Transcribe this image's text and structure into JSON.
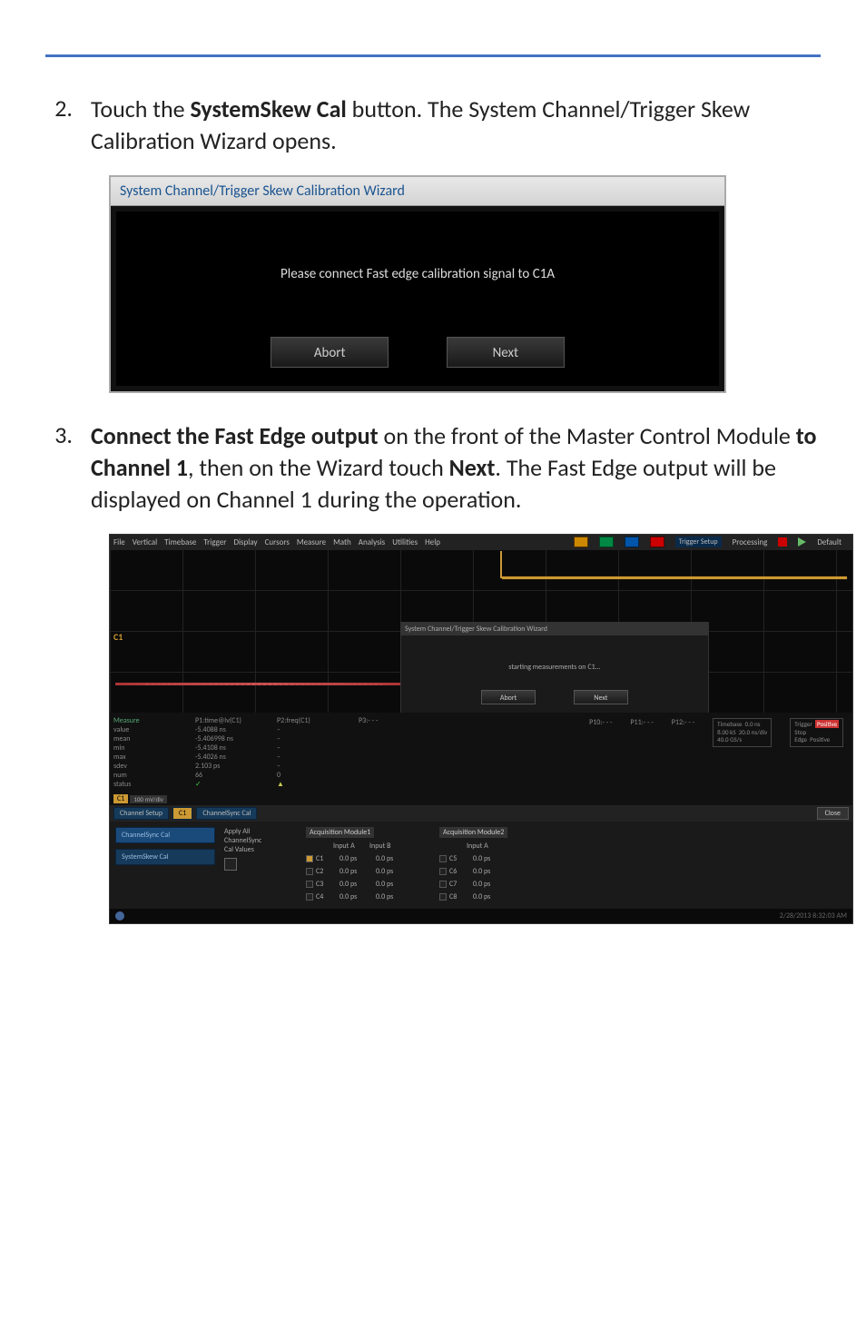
{
  "instructions": {
    "step2": {
      "num": "2.",
      "prefix": "Touch the ",
      "bold1": "SystemSkew Cal",
      "suffix": " button. The System Channel/Trigger Skew Calibration Wizard opens."
    },
    "step3": {
      "num": "3.",
      "bold1": "Connect the Fast Edge output",
      "mid1": " on the front of the Master Control Module ",
      "bold2": "to Channel 1",
      "mid2": ", then on the Wizard touch ",
      "bold3": "Next",
      "suffix": ".  The Fast Edge output will be displayed on Channel 1 during the operation."
    }
  },
  "dialog": {
    "title": "System Channel/Trigger Skew Calibration Wizard",
    "message": "Please connect Fast edge calibration signal to C1A",
    "abort": "Abort",
    "next": "Next"
  },
  "scope": {
    "menu": [
      "File",
      "Vertical",
      "Timebase",
      "Trigger",
      "Display",
      "Cursors",
      "Measure",
      "Math",
      "Analysis",
      "Utilities",
      "Help"
    ],
    "trigger_setup": "Trigger Setup",
    "processing": "Processing",
    "default": "Default",
    "inner_wizard": {
      "title": "System Channel/Trigger Skew Calibration Wizard",
      "message": "starting measurements on C1...",
      "abort": "Abort",
      "next": "Next"
    },
    "ch_label": "C1",
    "measure": {
      "header_measure": "Measure",
      "header_p1": "P1:time@lv(C1)",
      "header_p2": "P2:freq(C1)",
      "header_p3": "P3:- - -",
      "rows_lbl": [
        "value",
        "mean",
        "min",
        "max",
        "sdev",
        "num",
        "status"
      ],
      "rows_p1": [
        "-5.4088 ns",
        "-5.406998 ns",
        "-5.4108 ns",
        "-5.4026 ns",
        "2.103 ps",
        "66",
        "✓"
      ],
      "rows_p2": [
        "–",
        "–",
        "–",
        "–",
        "–",
        "0",
        "▲"
      ],
      "badge_c1": "C1",
      "badge_line1": "100 mV/div",
      "p_right": [
        "P10:- - -",
        "P11:- - -",
        "P12:- - -"
      ]
    },
    "right_status": {
      "timebase": "Timebase",
      "timebase_val": "0.0 ns",
      "timebase_l2a": "8.00 kS",
      "timebase_l2b": "20.0 ns/div",
      "timebase_l3": "40.0 GS/s",
      "trigger": "Trigger",
      "trigger_val": "Positive",
      "trigger_l2": "Stop",
      "trigger_l3": "Edge",
      "trigger_pos": "Positive"
    },
    "tabs": {
      "channel_setup": "Channel Setup",
      "c1": "C1",
      "channelsync_cal": "ChannelSync Cal",
      "close": "Close"
    },
    "side": {
      "channelsync_cal": "ChannelSync Cal",
      "systemskew_cal": "SystemSkew Cal"
    },
    "apply": {
      "label1": "Apply All",
      "label2": "ChannelSync",
      "label3": "Cal Values"
    },
    "acq": {
      "mod1": "Acquisition Module1",
      "mod2": "Acquisition Module2",
      "inputA": "Input A",
      "inputB": "Input B",
      "ch": [
        "C1",
        "C2",
        "C3",
        "C4"
      ],
      "ch2": [
        "C5",
        "C6",
        "C7",
        "C8"
      ],
      "val": "0.0 ps"
    },
    "status_time": "2/28/2013 8:32:03 AM"
  }
}
